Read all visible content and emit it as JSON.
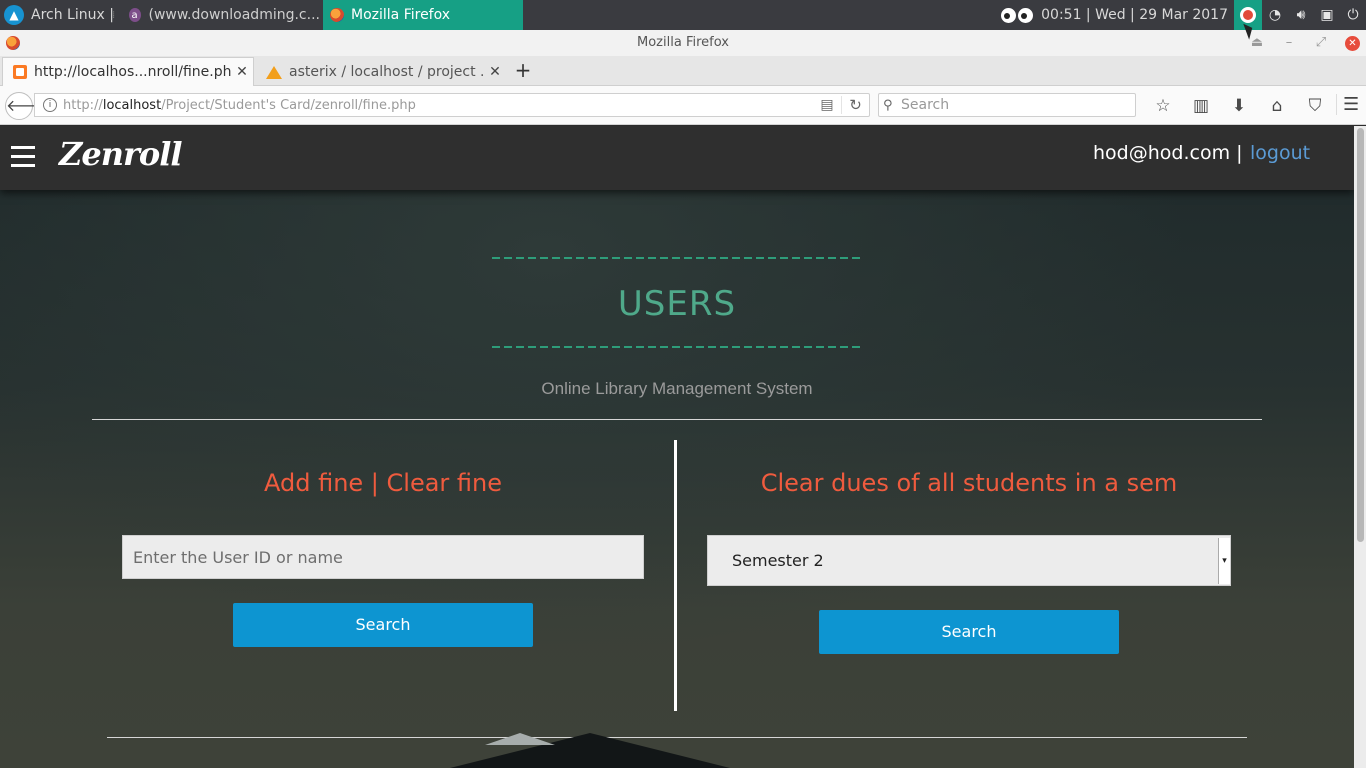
{
  "taskbar": {
    "os_label": "Arch Linux  |",
    "task1_title": "(www.downloadming.c...",
    "task2_title": "Mozilla Firefox",
    "clock": "00:51  |  Wed  |  29 Mar 2017",
    "accent_color": "#16a085"
  },
  "window": {
    "title": "Mozilla Firefox"
  },
  "tabs": [
    {
      "label": "http://localhos...nroll/fine.php",
      "icon": "xampp-icon"
    },
    {
      "label": "asterix / localhost / project ...",
      "icon": "phpmyadmin-icon"
    }
  ],
  "navbar": {
    "url_prefix": "http://",
    "url_host": "localhost",
    "url_path": "/Project/Student's Card/zenroll/fine.php",
    "search_placeholder": "Search"
  },
  "site": {
    "brand": "Zenroll",
    "user_email": "hod@hod.com |",
    "logout_label": "logout"
  },
  "main": {
    "heading": "USERS",
    "tagline": "Online Library Management System",
    "heading_color": "#4fa98a",
    "accent_color": "#ef5b3e",
    "button_color": "#0d95d1"
  },
  "left_panel": {
    "title": "Add fine | Clear fine",
    "input_placeholder": "Enter the User ID or name",
    "button_label": "Search"
  },
  "right_panel": {
    "title": "Clear dues of all students in a sem",
    "selected_semester": "Semester 2",
    "button_label": "Search"
  }
}
